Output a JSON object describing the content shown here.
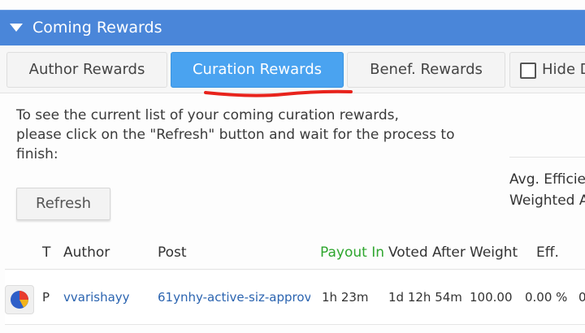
{
  "panel": {
    "title": "Coming Rewards"
  },
  "tabs": [
    {
      "label": "Author Rewards"
    },
    {
      "label": "Curation Rewards"
    },
    {
      "label": "Benef. Rewards"
    },
    {
      "label": "Hide D"
    }
  ],
  "info": {
    "line1": "To see the current list of your coming curation rewards,",
    "line2": "please click on the \"Refresh\" button and wait for the process to",
    "line3": "finish:"
  },
  "refresh_label": "Refresh",
  "side": {
    "line1": "Avg. Efficie",
    "line2": "Weighted A"
  },
  "table": {
    "headers": [
      "T",
      "Author",
      "Post",
      "Payout In",
      "Voted After",
      "Weight",
      "Eff."
    ],
    "row": {
      "type": "P",
      "author": "vvarishayy",
      "post": "61ynhy-active-siz-approv",
      "payout_in": "1h 23m",
      "voted_after": "1d 12h 54m",
      "weight": "100.00",
      "eff": "0.00 %",
      "extra": "0"
    }
  },
  "colors": {
    "header_blue": "#4a86d9",
    "active_tab": "#4aa3f0",
    "payout_green": "#2ea62e",
    "red_mark": "#e8231c"
  }
}
